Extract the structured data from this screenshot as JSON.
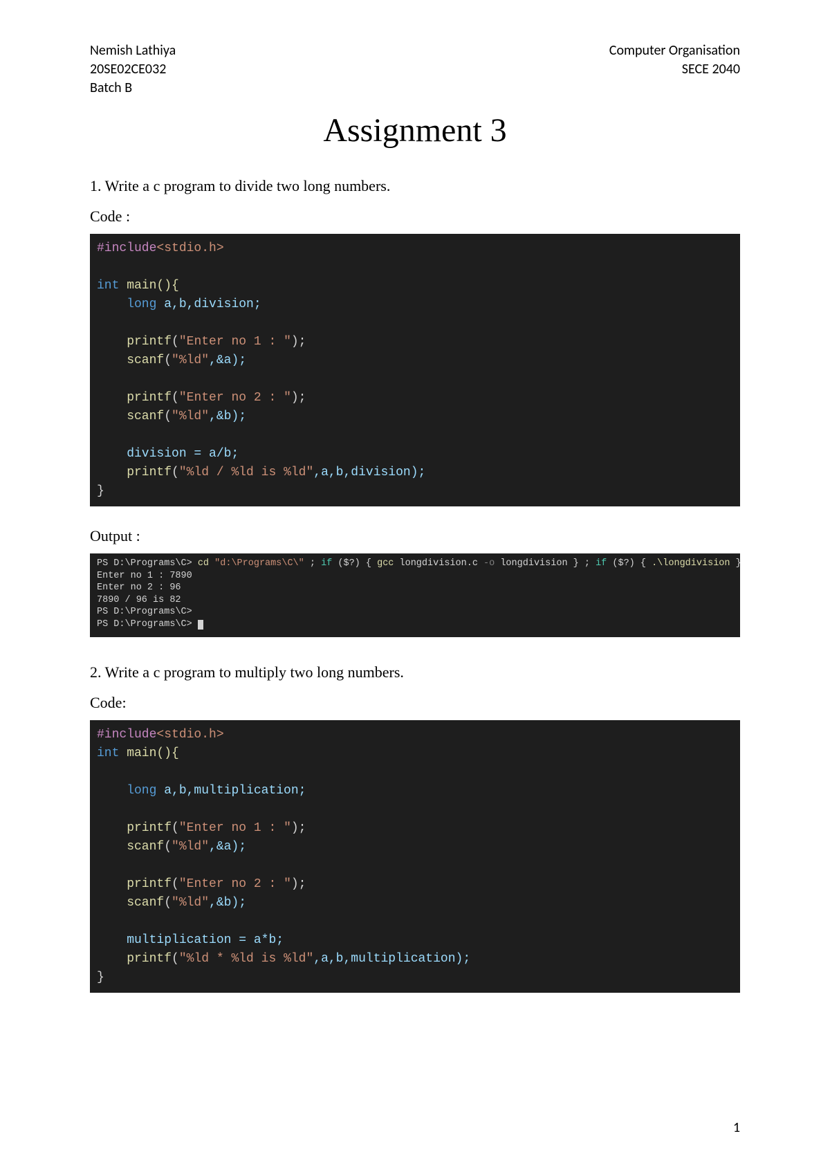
{
  "header": {
    "name": "Nemish Lathiya",
    "id": "20SE02CE032",
    "batch": "Batch B",
    "course": "Computer Organisation",
    "code": "SECE 2040"
  },
  "title": "Assignment 3",
  "q1": {
    "prompt": "1. Write a c program to divide two long numbers.",
    "code_label": "Code :",
    "output_label": "Output :",
    "code": {
      "l1_include": "#include",
      "l1_header": "<stdio.h>",
      "l3_int": "int",
      "l3_main": " main(){",
      "l4_long": "    long",
      "l4_vars": " a,b,division;",
      "l6_printf": "    printf",
      "l6_open": "(",
      "l6_str": "\"Enter no 1 : \"",
      "l6_close": ");",
      "l7_scanf": "    scanf",
      "l7_open": "(",
      "l7_str": "\"%ld\"",
      "l7_rest": ",&a);",
      "l9_printf": "    printf",
      "l9_open": "(",
      "l9_str": "\"Enter no 2 : \"",
      "l9_close": ");",
      "l10_scanf": "    scanf",
      "l10_open": "(",
      "l10_str": "\"%ld\"",
      "l10_rest": ",&b);",
      "l12": "    division = a/b;",
      "l13_printf": "    printf",
      "l13_open": "(",
      "l13_str": "\"%ld / %ld is %ld\"",
      "l13_rest": ",a,b,division);",
      "l14": "}"
    },
    "term": {
      "l1_ps": "PS D:\\Programs\\C> ",
      "l1_cd": "cd ",
      "l1_path": "\"d:\\Programs\\C\\\"",
      "l1_semi1": " ; ",
      "l1_if1": "if",
      "l1_cond1": " ($?) { ",
      "l1_gcc": "gcc",
      "l1_args": " longdivision.c ",
      "l1_o": "-o",
      "l1_out": " longdivision } ; ",
      "l1_if2": "if",
      "l1_cond2": " ($?) { ",
      "l1_run": ".\\longdivision",
      "l1_end": " }",
      "l2": "Enter no 1 : 7890",
      "l3": "Enter no 2 : 96",
      "l4": "7890 / 96 is 82",
      "l5": "PS D:\\Programs\\C>",
      "l6": "PS D:\\Programs\\C> "
    }
  },
  "q2": {
    "prompt": "2. Write a c program to multiply two long numbers.",
    "code_label": "Code:",
    "code": {
      "l1_include": "#include",
      "l1_header": "<stdio.h>",
      "l2_int": "int",
      "l2_main": " main(){",
      "l4_long": "    long",
      "l4_vars": " a,b,multiplication;",
      "l6_printf": "    printf",
      "l6_open": "(",
      "l6_str": "\"Enter no 1 : \"",
      "l6_close": ");",
      "l7_scanf": "    scanf",
      "l7_open": "(",
      "l7_str": "\"%ld\"",
      "l7_rest": ",&a);",
      "l9_printf": "    printf",
      "l9_open": "(",
      "l9_str": "\"Enter no 2 : \"",
      "l9_close": ");",
      "l10_scanf": "    scanf",
      "l10_open": "(",
      "l10_str": "\"%ld\"",
      "l10_rest": ",&b);",
      "l12": "    multiplication = a*b;",
      "l13_printf": "    printf",
      "l13_open": "(",
      "l13_str": "\"%ld * %ld is %ld\"",
      "l13_rest": ",a,b,multiplication);",
      "l14": "}"
    }
  },
  "page_number": "1"
}
